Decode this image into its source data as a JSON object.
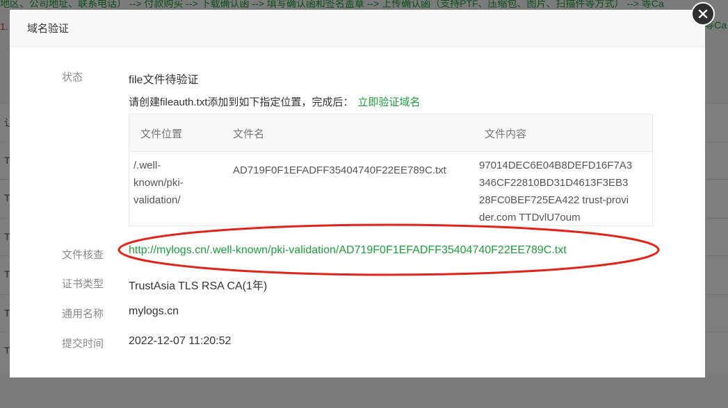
{
  "background": {
    "steps_text": "地区、公司地址、联系电话） --> 付款购买 --> 下载确认函 --> 填写确认函和签名盖章 --> 上传确认函（支持PTF、压缩包、图片、扫描件等方式） --> 等Ca",
    "left_mark": "1.",
    "row_left_chars": [
      "让",
      "T",
      "T",
      "T",
      "T",
      "T",
      "T"
    ],
    "right_edge_text": "等Ca"
  },
  "modal": {
    "title": "域名验证",
    "status": {
      "label": "状态",
      "value": "file文件待验证"
    },
    "instruction": {
      "text": "请创建fileauth.txt添加到如下指定位置，完成后：",
      "link": "立即验证域名"
    },
    "file_table": {
      "headers": [
        "文件位置",
        "文件名",
        "文件内容"
      ],
      "row": {
        "location_lines": [
          "/.well-",
          "known/pki-",
          "validation/"
        ],
        "filename": "AD719F0F1EFADFF35404740F22EE789C.txt",
        "content_lines": [
          "97014DEC6E04B8DEFD16F7A3",
          "346CF22810BD31D4613F3EB3",
          "28FC0BEF725EA422 trust-provi",
          "der.com TTDvlU7oum"
        ]
      }
    },
    "file_check": {
      "label": "文件核查",
      "url": "http://mylogs.cn/.well-known/pki-validation/AD719F0F1EFADFF35404740F22EE789C.txt"
    },
    "cert_type": {
      "label": "证书类型",
      "value": "TrustAsia TLS RSA CA(1年)"
    },
    "common_name": {
      "label": "通用名称",
      "value": "mylogs.cn"
    },
    "submit_time": {
      "label": "提交时间",
      "value": "2022-12-07 11:20:52"
    }
  },
  "colors": {
    "link_green": "#1a9e3a",
    "annotation_red": "#e2231a",
    "overlay": "#000000"
  },
  "icons": {
    "close": "close-icon"
  }
}
